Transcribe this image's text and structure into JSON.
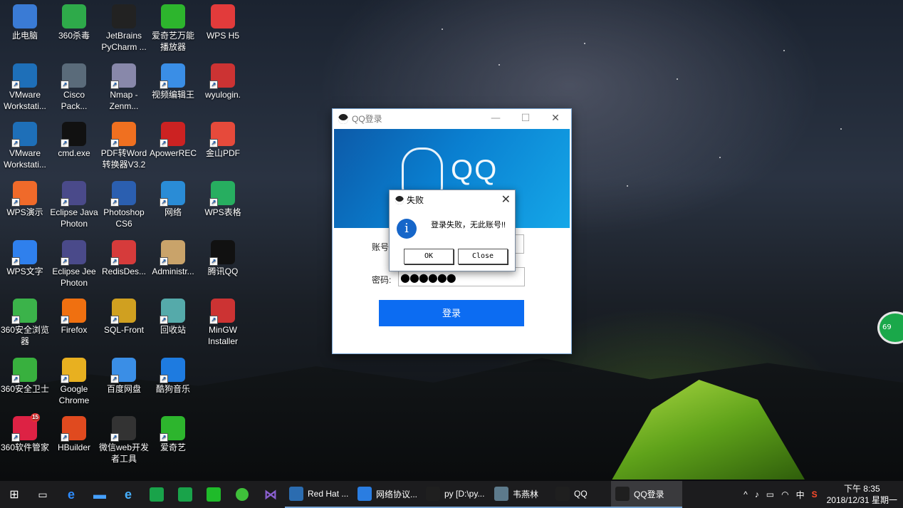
{
  "desktop": {
    "icons": [
      {
        "label": "此电脑"
      },
      {
        "label": "360杀毒"
      },
      {
        "label": "JetBrains PyCharm ..."
      },
      {
        "label": "爱奇艺万能播放器"
      },
      {
        "label": "WPS H5"
      },
      {
        "label": "VMware Workstati..."
      },
      {
        "label": "Cisco Pack..."
      },
      {
        "label": "Nmap - Zenm..."
      },
      {
        "label": "视频编辑王"
      },
      {
        "label": "wyulogin."
      },
      {
        "label": "VMware Workstati..."
      },
      {
        "label": "cmd.exe"
      },
      {
        "label": "PDF转Word转换器V3.2"
      },
      {
        "label": "ApowerREC"
      },
      {
        "label": "金山PDF"
      },
      {
        "label": "WPS演示"
      },
      {
        "label": "Eclipse Java Photon"
      },
      {
        "label": "Photoshop CS6"
      },
      {
        "label": "网络"
      },
      {
        "label": "WPS表格"
      },
      {
        "label": "WPS文字"
      },
      {
        "label": "Eclipse Jee Photon"
      },
      {
        "label": "RedisDes..."
      },
      {
        "label": "Administr..."
      },
      {
        "label": "腾讯QQ"
      },
      {
        "label": "360安全浏览器"
      },
      {
        "label": "Firefox"
      },
      {
        "label": "SQL-Front"
      },
      {
        "label": "回收站"
      },
      {
        "label": "MinGW Installer"
      },
      {
        "label": "360安全卫士"
      },
      {
        "label": "Google Chrome"
      },
      {
        "label": "百度网盘"
      },
      {
        "label": "酷狗音乐"
      },
      {
        "label": "360软件管家"
      },
      {
        "label": "HBuilder"
      },
      {
        "label": "微信web开发者工具"
      },
      {
        "label": "爱奇艺"
      }
    ],
    "badge_15": "15",
    "side_badge": "69"
  },
  "qq_window": {
    "title": "QQ登录",
    "logo_text": "QQ",
    "account_label": "账号",
    "password_label": "密码:",
    "password_value": "●●●●●●",
    "login_button": "登录",
    "minimize": "—",
    "maximize": "☐",
    "close": "✕"
  },
  "dialog": {
    "title": "失败",
    "message": "登录失败，无此账号!!",
    "ok": "OK",
    "close": "Close",
    "x": "✕"
  },
  "taskbar": {
    "tasks": [
      {
        "label": "Red Hat ...",
        "color": "#2b6cb0"
      },
      {
        "label": "网络协议...",
        "color": "#2a7de1"
      },
      {
        "label": "py [D:\\py...",
        "color": "#1f1f1f"
      },
      {
        "label": "韦燕林",
        "color": "#5d7a8c"
      },
      {
        "label": "QQ",
        "color": "#1f1f1f"
      },
      {
        "label": "QQ登录",
        "color": "#1f1f1f"
      }
    ],
    "ime": "中",
    "time": "下午 8:35",
    "date": "2018/12/31 星期一"
  }
}
